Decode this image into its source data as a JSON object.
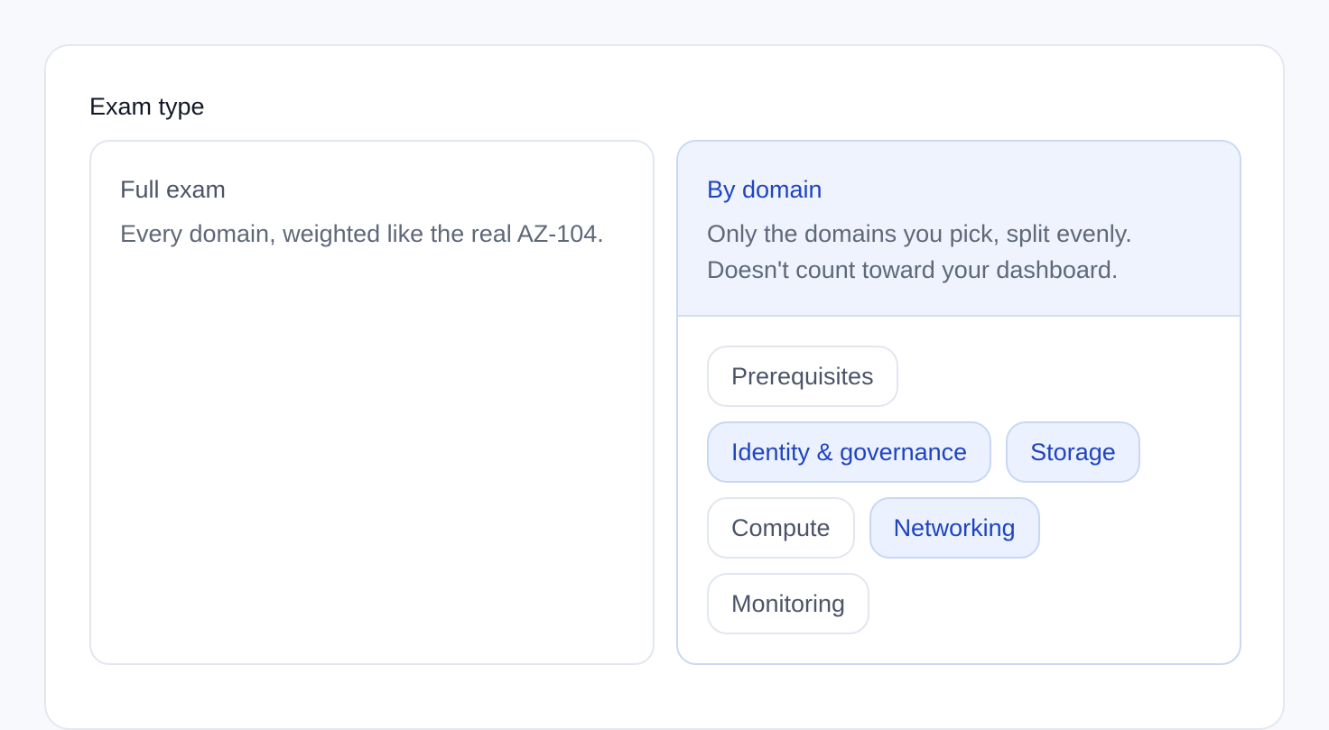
{
  "section": {
    "label": "Exam type"
  },
  "options": {
    "full": {
      "title": "Full exam",
      "description": "Every domain, weighted like the real AZ-104."
    },
    "domain": {
      "title": "By domain",
      "description_line1": "Only the domains you pick, split evenly.",
      "description_line2": "Doesn't count toward your dashboard."
    }
  },
  "domains": [
    {
      "label": "Prerequisites",
      "selected": false
    },
    {
      "label": "Identity & governance",
      "selected": true
    },
    {
      "label": "Storage",
      "selected": true
    },
    {
      "label": "Compute",
      "selected": false
    },
    {
      "label": "Networking",
      "selected": true
    },
    {
      "label": "Monitoring",
      "selected": false
    }
  ],
  "colors": {
    "accent": "#1f44c0",
    "selected_bg": "#ebf1fe",
    "muted_text": "#4b5468"
  }
}
